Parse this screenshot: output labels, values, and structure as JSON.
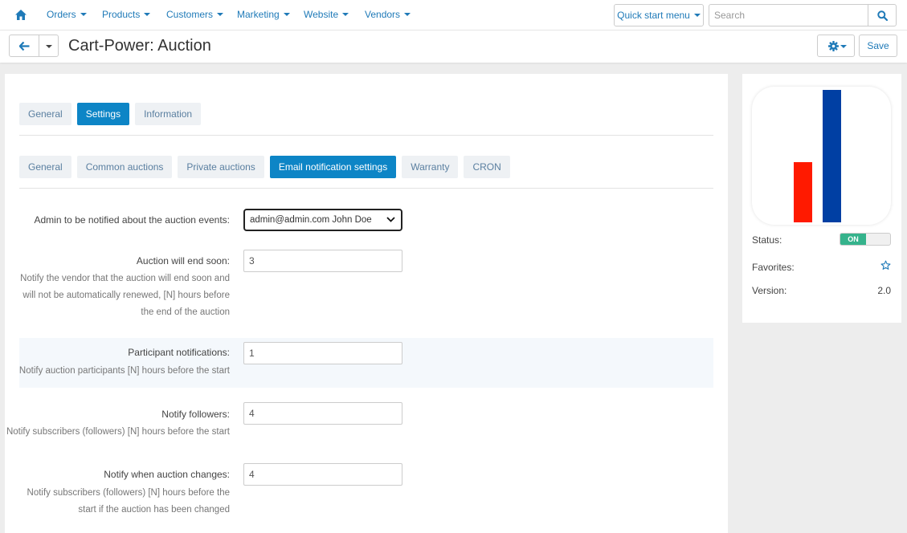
{
  "nav": {
    "items": [
      "Orders",
      "Products",
      "Customers",
      "Marketing",
      "Website",
      "Vendors"
    ],
    "quick_start": "Quick start menu",
    "search_placeholder": "Search"
  },
  "header": {
    "title": "Cart-Power: Auction",
    "save_label": "Save"
  },
  "main_tabs": [
    "General",
    "Settings",
    "Information"
  ],
  "main_tabs_active": "Settings",
  "sub_tabs": [
    "General",
    "Common auctions",
    "Private auctions",
    "Email notification settings",
    "Warranty",
    "CRON"
  ],
  "sub_tabs_active": "Email notification settings",
  "form": {
    "admin_label": "Admin to be notified about the auction events:",
    "admin_value": "admin@admin.com John Doe",
    "end_soon_label": "Auction will end soon:",
    "end_soon_value": "3",
    "end_soon_hint": "Notify the vendor that the auction will end soon and will not be automatically renewed, [N] hours before the end of the auction",
    "participant_label": "Participant notifications:",
    "participant_value": "1",
    "participant_hint": "Notify auction participants [N] hours before the start",
    "followers_label": "Notify followers:",
    "followers_value": "4",
    "followers_hint": "Notify subscribers (followers) [N] hours before the start",
    "changes_label": "Notify when auction changes:",
    "changes_value": "4",
    "changes_hint": "Notify subscribers (followers) [N] hours before the start if the auction has been changed"
  },
  "side": {
    "status_label": "Status:",
    "status_value": "ON",
    "favorites_label": "Favorites:",
    "version_label": "Version:",
    "version_value": "2.0"
  },
  "colors": {
    "accent": "#0d85c6",
    "link": "#1f7ab8",
    "status_on": "#35b38c",
    "logo_red": "#ff1a00",
    "logo_blue": "#003fa3"
  },
  "icons": {
    "home": "home-icon",
    "search": "search-icon",
    "back": "arrow-left-icon",
    "settings": "gear-icon",
    "select": "chevron-down-icon",
    "favorite": "star-icon"
  }
}
